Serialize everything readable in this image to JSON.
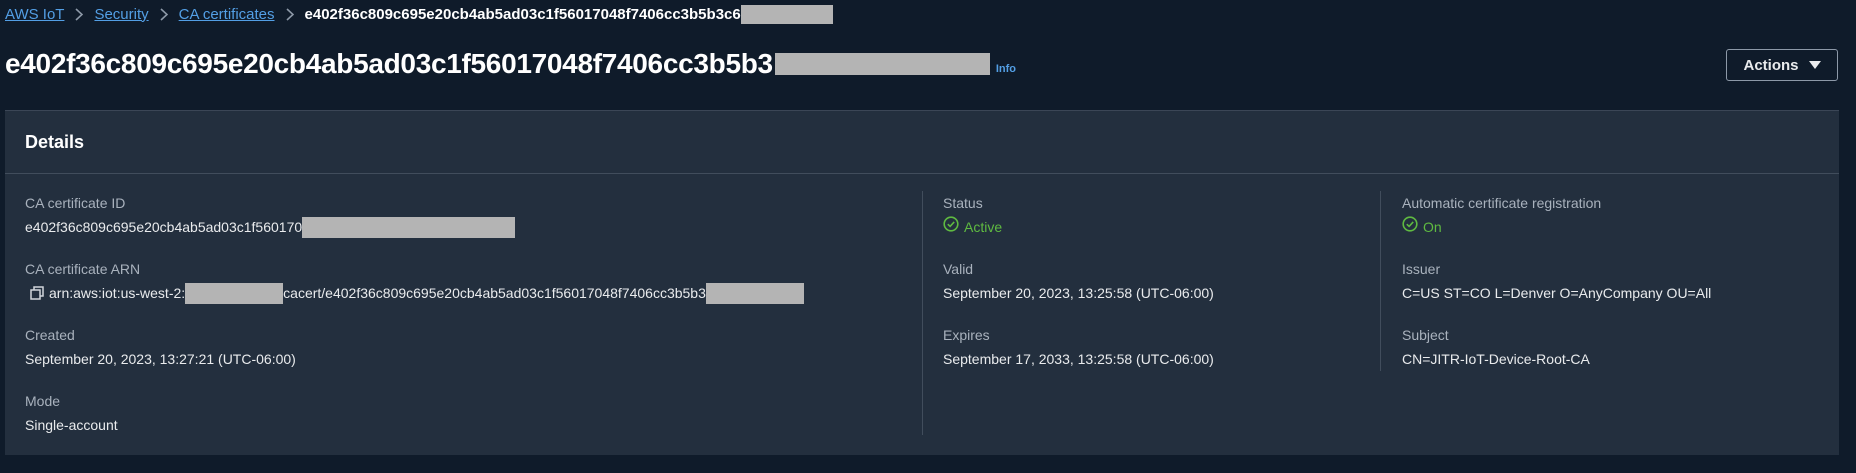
{
  "breadcrumb": {
    "items": [
      "AWS IoT",
      "Security",
      "CA certificates"
    ],
    "current": "e402f36c809c695e20cb4ab5ad03c1f56017048f7406cc3b5b3c6"
  },
  "header": {
    "title": "e402f36c809c695e20cb4ab5ad03c1f56017048f7406cc3b5b3",
    "info": "Info",
    "actions_label": "Actions"
  },
  "details": {
    "title": "Details",
    "ca_cert_id": {
      "label": "CA certificate ID",
      "value": "e402f36c809c695e20cb4ab5ad03c1f560170"
    },
    "ca_cert_arn": {
      "label": "CA certificate ARN",
      "value_prefix": "arn:aws:iot:us-west-2:",
      "value_suffix": "cacert/e402f36c809c695e20cb4ab5ad03c1f56017048f7406cc3b5b3"
    },
    "created": {
      "label": "Created",
      "value": "September 20, 2023, 13:27:21 (UTC-06:00)"
    },
    "mode": {
      "label": "Mode",
      "value": "Single-account"
    },
    "status": {
      "label": "Status",
      "value": "Active"
    },
    "valid": {
      "label": "Valid",
      "value": "September 20, 2023, 13:25:58 (UTC-06:00)"
    },
    "expires": {
      "label": "Expires",
      "value": "September 17, 2033, 13:25:58 (UTC-06:00)"
    },
    "auto_reg": {
      "label": "Automatic certificate registration",
      "value": "On"
    },
    "issuer": {
      "label": "Issuer",
      "value": "C=US ST=CO L=Denver O=AnyCompany OU=All"
    },
    "subject": {
      "label": "Subject",
      "value": "CN=JITR-IoT-Device-Root-CA"
    }
  },
  "colors": {
    "link": "#539fe5",
    "success": "#5fba41",
    "panel": "#232f3e",
    "background": "#0f1b2a"
  }
}
